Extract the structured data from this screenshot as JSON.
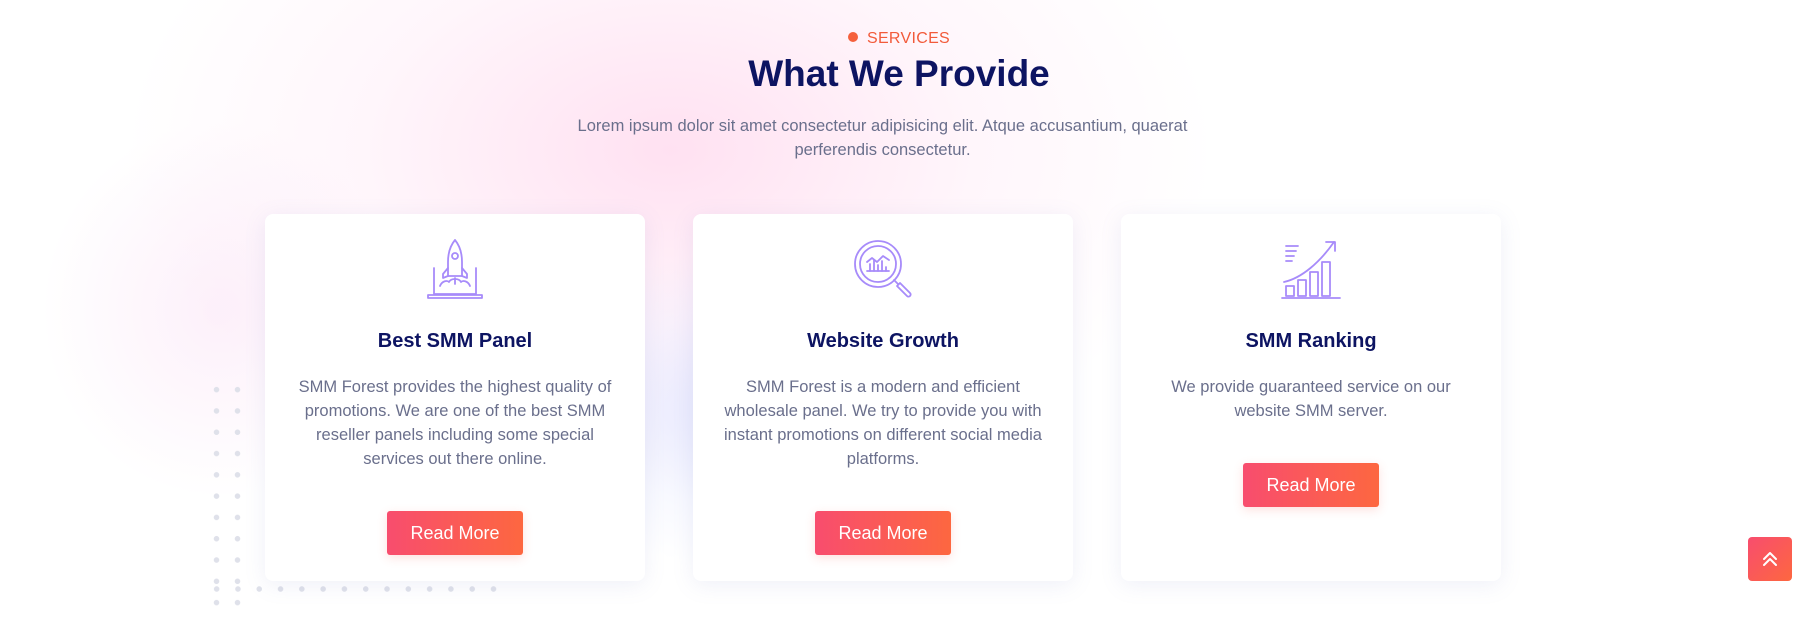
{
  "section": {
    "eyebrow": "SERVICES",
    "title": "What We Provide",
    "subtitle": "Lorem ipsum dolor sit amet consectetur adipisicing elit. Atque accusantium, quaerat perferendis consectetur."
  },
  "cards": [
    {
      "icon": "rocket-laptop-icon",
      "title": "Best SMM Panel",
      "text": "SMM Forest provides the highest quality of promotions. We are one of the best SMM reseller panels including some special services out there online.",
      "button": "Read More"
    },
    {
      "icon": "magnifier-chart-icon",
      "title": "Website Growth",
      "text": "SMM Forest is a modern and efficient wholesale panel. We try to provide you with instant promotions on different social media platforms.",
      "button": "Read More"
    },
    {
      "icon": "growth-chart-icon",
      "title": "SMM Ranking",
      "text": "We provide guaranteed service on our website SMM server.",
      "button": "Read More"
    }
  ],
  "scroll_top": {
    "icon": "double-chevron-up-icon"
  },
  "colors": {
    "accent": "#f25a3a",
    "heading": "#0d1462",
    "body_text": "#6a6f8c",
    "icon": "#a78bfa",
    "button_start": "#f84d6e",
    "button_end": "#fd6740"
  }
}
